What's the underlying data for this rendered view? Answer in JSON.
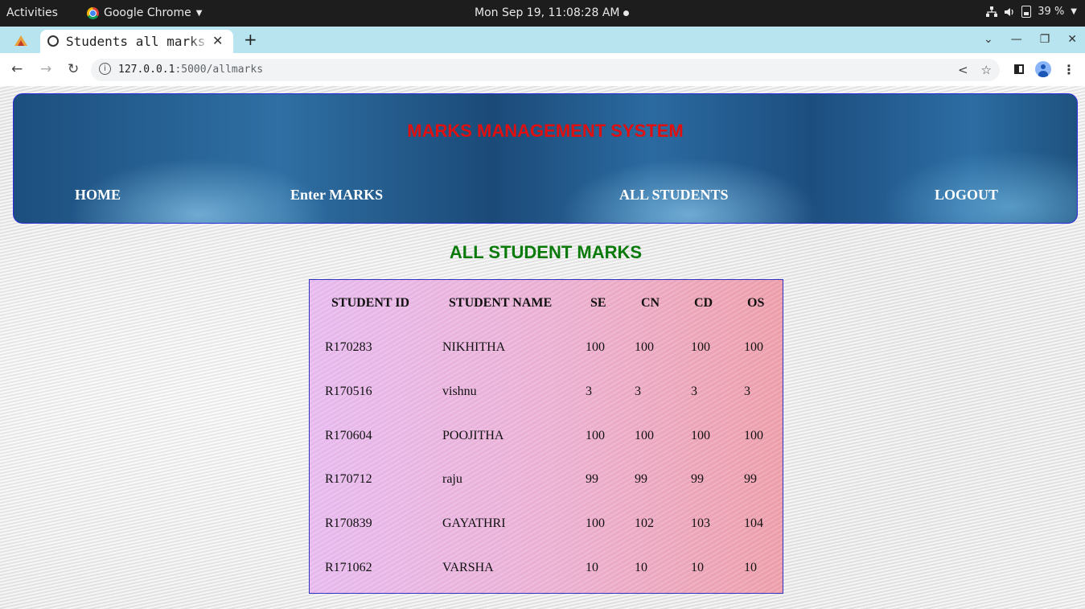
{
  "system_bar": {
    "activities": "Activities",
    "app_name": "Google Chrome",
    "clock": "Mon Sep 19, 11:08:28 AM",
    "battery": "39 %"
  },
  "browser": {
    "tab_title": "Students all marks",
    "url_host": "127.0.0.1",
    "url_path": ":5000/allmarks"
  },
  "site": {
    "title": "MARKS MANAGEMENT SYSTEM",
    "nav": [
      "HOME",
      "Enter MARKS",
      "ALL STUDENTS",
      "LOGOUT"
    ]
  },
  "section_title": "ALL STUDENT MARKS",
  "table": {
    "headers": [
      "STUDENT ID",
      "STUDENT NAME",
      "SE",
      "CN",
      "CD",
      "OS"
    ],
    "rows": [
      [
        "R170283",
        "NIKHITHA",
        "100",
        "100",
        "100",
        "100"
      ],
      [
        "R170516",
        "vishnu",
        "3",
        "3",
        "3",
        "3"
      ],
      [
        "R170604",
        "POOJITHA",
        "100",
        "100",
        "100",
        "100"
      ],
      [
        "R170712",
        "raju",
        "99",
        "99",
        "99",
        "99"
      ],
      [
        "R170839",
        "GAYATHRI",
        "100",
        "102",
        "103",
        "104"
      ],
      [
        "R171062",
        "VARSHA",
        "10",
        "10",
        "10",
        "10"
      ]
    ]
  },
  "colors": {
    "site_title": "#e01010",
    "section_title": "#0a7a0a",
    "header_bg": "#2a6496",
    "tab_strip": "#b7e4ef"
  }
}
